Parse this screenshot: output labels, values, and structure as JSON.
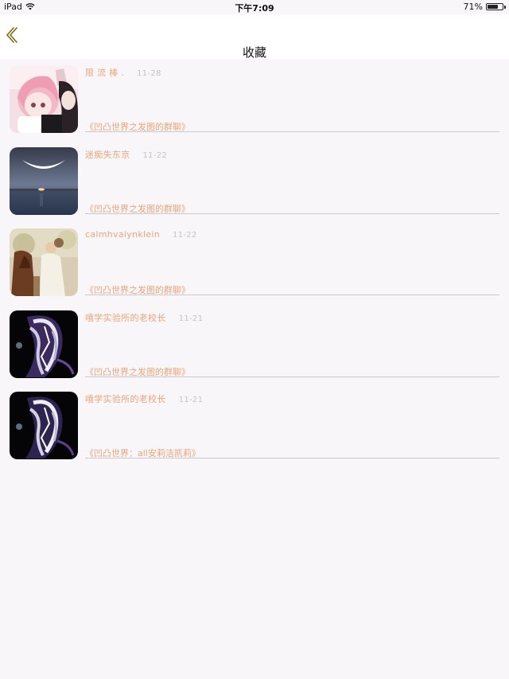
{
  "status_bar": {
    "device": "iPad",
    "time": "下午7:09",
    "battery": "71%",
    "battery_level": 0.71
  },
  "nav": {
    "title": "收藏",
    "back_icon": "chevron-left-icon",
    "accent": "#7a6a10"
  },
  "items": [
    {
      "author": "限 流 棒 .",
      "date": "11-28",
      "group": "《凹凸世界之发图的群聊》"
    },
    {
      "author": "迷痴失东京",
      "date": "11-22",
      "group": "《凹凸世界之发图的群聊》"
    },
    {
      "author": "calmhvaiynklein",
      "date": "11-22",
      "group": "《凹凸世界之发图的群聊》"
    },
    {
      "author": "嘻学实验所的老校长",
      "date": "11-21",
      "group": "《凹凸世界之发图的群聊》"
    },
    {
      "author": "嘻学实验所的老校长",
      "date": "11-21",
      "group": "《凹凸世界：all安莉洁凯莉》"
    }
  ],
  "colors": {
    "text_accent": "#e9a57a",
    "date": "#c4c4c4",
    "divider": "#c9c9c9",
    "background": "#f8f6f8"
  }
}
